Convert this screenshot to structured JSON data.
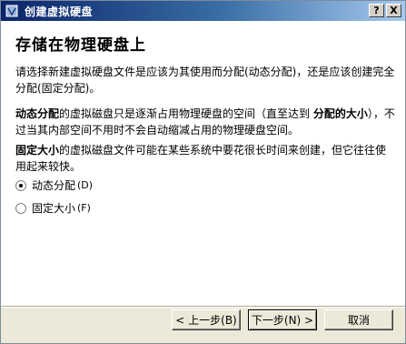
{
  "window": {
    "title": "创建虚拟硬盘",
    "help_button": "?",
    "close_button": "X"
  },
  "page": {
    "heading": "存储在物理硬盘上",
    "paragraph1": "请选择新建虚拟硬盘文件是应该为其使用而分配(动态分配)，还是应该创建完全分配(固定分配)。",
    "paragraph2_bold1": "动态分配",
    "paragraph2_mid": "的虚拟磁盘只是逐渐占用物理硬盘的空间（直至达到 ",
    "paragraph2_bold2": "分配的大小",
    "paragraph2_end": "），不过当其内部空间不用时不会自动缩减占用的物理硬盘空间。",
    "paragraph3_bold": "固定大小",
    "paragraph3_rest": "的虚拟磁盘文件可能在某些系统中要花很长时间来创建，但它往往使用起来较快。"
  },
  "options": [
    {
      "label": "动态分配",
      "accel": "(D)",
      "selected": true
    },
    {
      "label": "固定大小",
      "accel": "(F)",
      "selected": false
    }
  ],
  "buttons": {
    "back": "< 上一步(B)",
    "next": "下一步(N) >",
    "cancel": "取消"
  }
}
